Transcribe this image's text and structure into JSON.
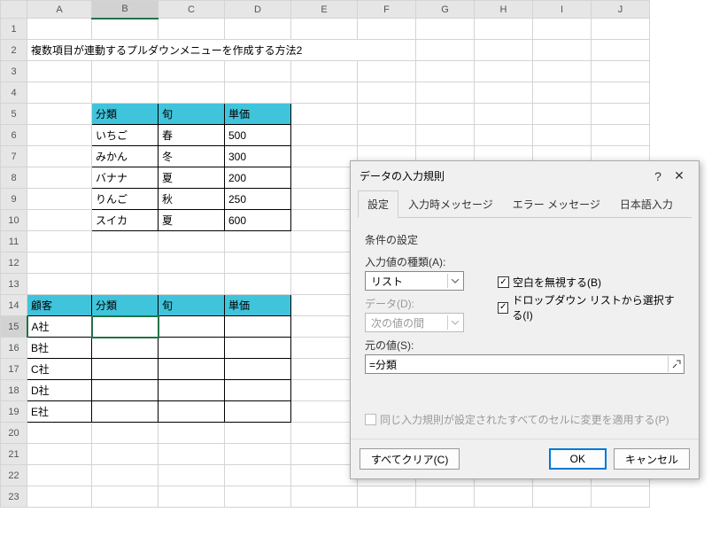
{
  "columns": [
    "A",
    "B",
    "C",
    "D",
    "E",
    "F",
    "G",
    "H",
    "I",
    "J"
  ],
  "rows": [
    "1",
    "2",
    "3",
    "4",
    "5",
    "6",
    "7",
    "8",
    "9",
    "10",
    "11",
    "12",
    "13",
    "14",
    "15",
    "16",
    "17",
    "18",
    "19",
    "20",
    "21",
    "22",
    "23"
  ],
  "active_cell": {
    "row": 15,
    "col": "B"
  },
  "title_cell": "複数項目が連動するプルダウンメニューを作成する方法2",
  "table1": {
    "headers": [
      "分類",
      "旬",
      "単価"
    ],
    "rows": [
      [
        "いちご",
        "春",
        "500"
      ],
      [
        "みかん",
        "冬",
        "300"
      ],
      [
        "バナナ",
        "夏",
        "200"
      ],
      [
        "りんご",
        "秋",
        "250"
      ],
      [
        "スイカ",
        "夏",
        "600"
      ]
    ]
  },
  "table2": {
    "headers": [
      "顧客",
      "分類",
      "旬",
      "単価"
    ],
    "rows": [
      "A社",
      "B社",
      "C社",
      "D社",
      "E社"
    ]
  },
  "dialog": {
    "title": "データの入力規則",
    "tabs": [
      "設定",
      "入力時メッセージ",
      "エラー メッセージ",
      "日本語入力"
    ],
    "section": "条件の設定",
    "allow_label": "入力値の種類(A):",
    "allow_value": "リスト",
    "data_label": "データ(D):",
    "data_value": "次の値の間",
    "ignore_blank": "空白を無視する(B)",
    "dropdown": "ドロップダウン リストから選択する(I)",
    "source_label": "元の値(S):",
    "source_value": "=分類",
    "apply_all": "同じ入力規則が設定されたすべてのセルに変更を適用する(P)",
    "clear": "すべてクリア(C)",
    "ok": "OK",
    "cancel": "キャンセル"
  }
}
